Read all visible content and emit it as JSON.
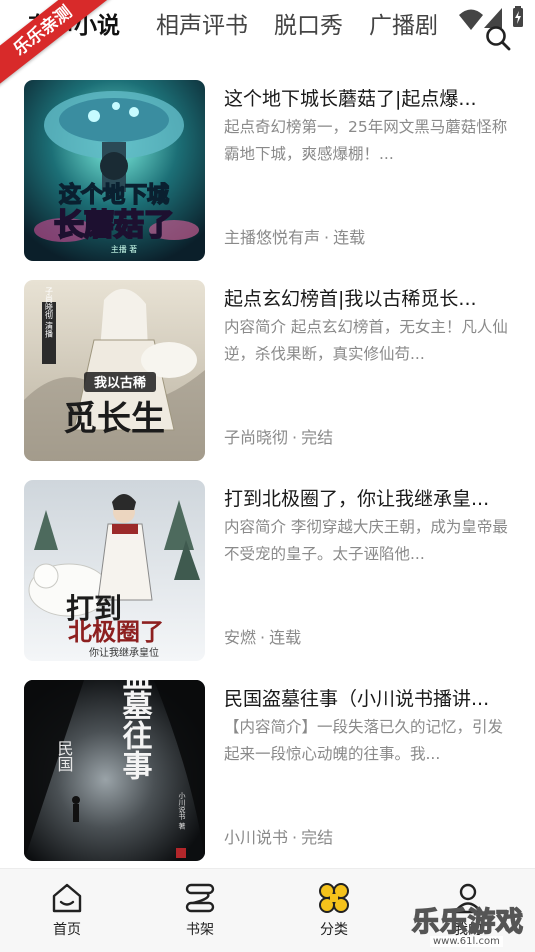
{
  "tabs": [
    {
      "label": "有声小说",
      "active": true
    },
    {
      "label": "相声评书",
      "active": false
    },
    {
      "label": "脱口秀",
      "active": false
    },
    {
      "label": "广播剧",
      "active": false
    }
  ],
  "ribbon": "乐乐亲测",
  "icons": {
    "search": "search-icon",
    "wifi": "wifi-icon",
    "signal": "signal-icon",
    "battery": "battery-icon"
  },
  "books": [
    {
      "title": "这个地下城长蘑菇了|起点爆...",
      "desc": "起点奇幻榜第一，25年网文黑马蘑菇怪称霸地下城，爽感爆棚！...",
      "author": "主播悠悦有声",
      "sep": "·",
      "status": "连载",
      "cover": {
        "line1": "这个地下城",
        "line2": "长蘑菇了",
        "small": "主播 著"
      }
    },
    {
      "title": "起点玄幻榜首|我以古稀觅长...",
      "desc": "内容简介 起点玄幻榜首，无女主！凡人仙逆，杀伐果断，真实修仙苟...",
      "author": "子尚晓彻",
      "sep": "·",
      "status": "完结",
      "cover": {
        "line1": "我以古稀",
        "line2": "觅长生",
        "side": "子尚晓彻 演播"
      }
    },
    {
      "title": "打到北极圈了，你让我继承皇...",
      "desc": "内容简介 李彻穿越大庆王朝，成为皇帝最不受宠的皇子。太子诬陷他...",
      "author": "安燃",
      "sep": "·",
      "status": "连载",
      "cover": {
        "line1": "打到",
        "line2": "北极圈了",
        "small": "你让我继承皇位"
      }
    },
    {
      "title": "民国盗墓往事（小川说书播讲...",
      "desc": "【内容简介】一段失落已久的记忆，引发起来一段惊心动魄的往事。我...",
      "author": "小川说书",
      "sep": "·",
      "status": "完结",
      "cover": {
        "line1": "民国",
        "line2": "盗墓往事",
        "side": "小川说书 著"
      }
    }
  ],
  "nav": [
    {
      "label": "首页",
      "icon": "home-icon"
    },
    {
      "label": "书架",
      "icon": "bookshelf-icon"
    },
    {
      "label": "分类",
      "icon": "category-icon"
    },
    {
      "label": "我的",
      "icon": "profile-icon"
    }
  ],
  "watermark": {
    "text": "乐乐游戏",
    "url": "www.61l.com"
  },
  "colors": {
    "accent": "#f5c21b",
    "ribbon": "#d82a2a",
    "text_primary": "#1a1a1a",
    "text_secondary": "#8a8a8a"
  }
}
